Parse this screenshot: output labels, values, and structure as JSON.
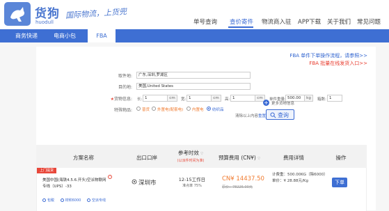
{
  "header": {
    "brand_cn": "货狗",
    "brand_en": "huodull",
    "slogan": "国际物流，上货兜",
    "nav": [
      "单号查询",
      "查价寄件",
      "物流商入驻",
      "APP下载",
      "关于我们",
      "常见问题"
    ],
    "active_nav": "查价寄件"
  },
  "tabs": [
    "商务快递",
    "电商小包",
    "FBA"
  ],
  "active_tab": "FBA",
  "fba_links": {
    "process": "FBA 单件下单操作流程，请参照>>",
    "batch": "FBA 批量在线发货入口>>"
  },
  "form": {
    "origin_label": "取件地:",
    "origin_value": "广东,深圳,罗湖区",
    "dest_label": "目的地:",
    "dest_value": "美国,United States",
    "cargo_label": "货物信息:",
    "long_label": "长:",
    "long_value": "1",
    "long_unit": "cm",
    "width_label": "宽:",
    "width_value": "1",
    "width_unit": "cm",
    "height_label": "高:",
    "height_value": "1",
    "height_unit": "cm",
    "weight_label": "单件重量:",
    "weight_value": "500.00",
    "weight_unit": "kg",
    "count_label": "箱数:",
    "count_value": "1",
    "special_label": "特殊物品:",
    "special_options": [
      "普货",
      "外置电(配套电)",
      "内置电",
      "纺织品"
    ],
    "special_selected": "纺织品"
  },
  "actions": {
    "more_cargo": "更多货物信息",
    "clear_prefix": "清除以上内容",
    "clear_link": "重置",
    "query_label": "查询"
  },
  "table": {
    "headers": {
      "plan": "方案名称",
      "port": "出口口岸",
      "time": "参考时效",
      "time_sub": "(以派件时间为准)",
      "fee": "预算费用 (CN¥)",
      "detail": "费用详情",
      "op": "操作"
    },
    "rows": [
      {
        "ribbon": "上门提货",
        "carrier": "美国中国(海铁4.5.6.开头)空派物联网专线（UPS）-33",
        "port": "深圳市",
        "time": "12-15工作日",
        "rate": "准点率 75%",
        "price": "CN¥ 14437.50",
        "orig_price": "原价：78225.00元",
        "detail_weight": "计费重：500.00KG（除6000）",
        "detail_unit": "单价：¥ 28.88元/Kg",
        "order_label": "下单",
        "tags": [
          "包税",
          "材积6000",
          "空派专线"
        ]
      }
    ]
  }
}
